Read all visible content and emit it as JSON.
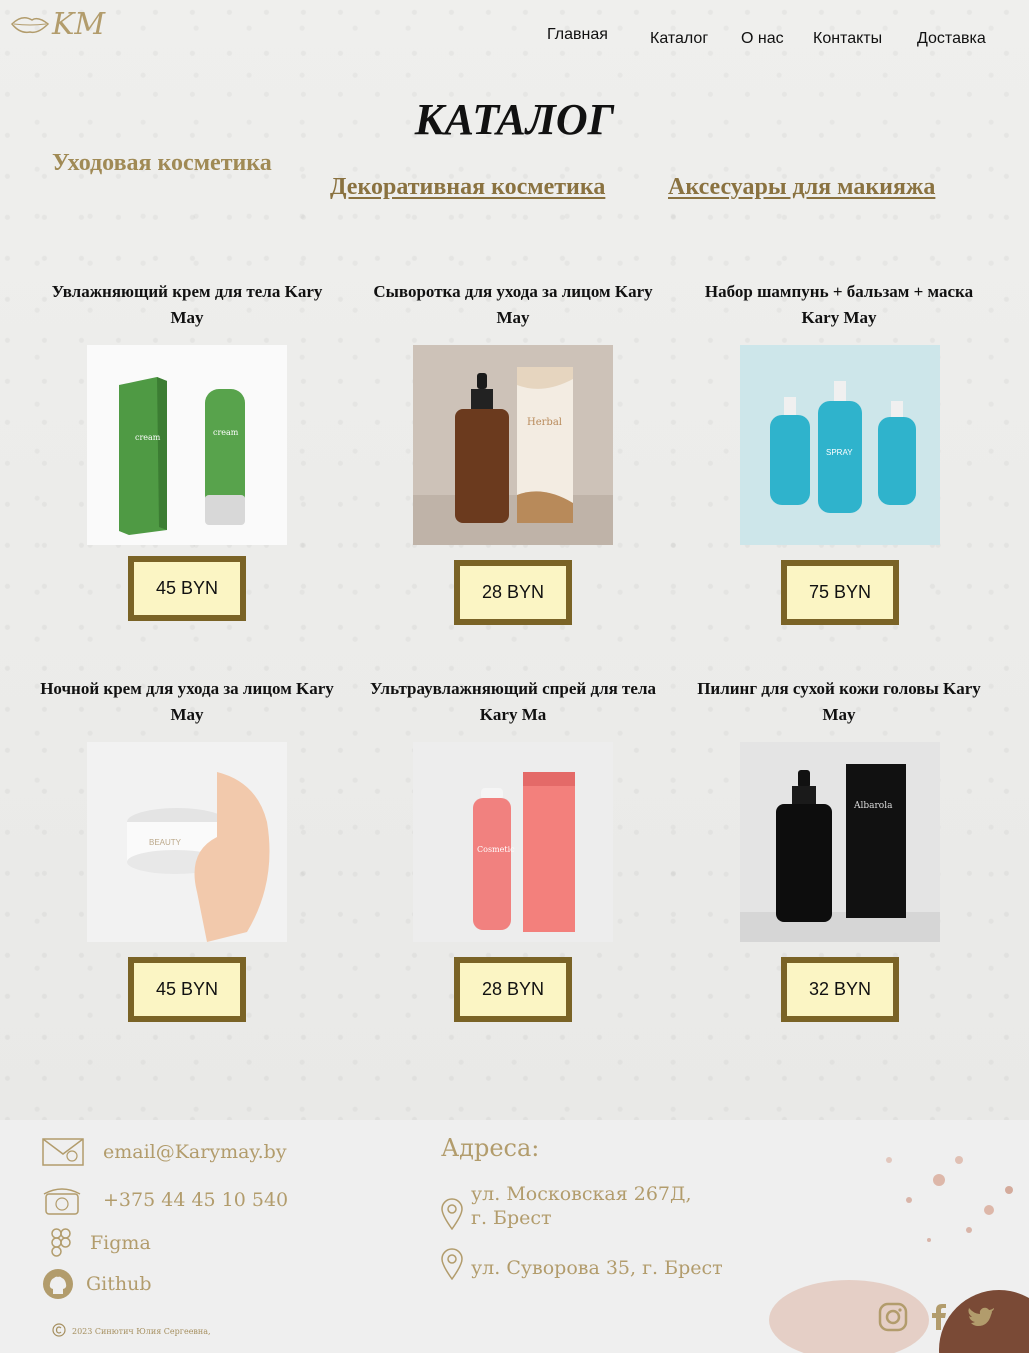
{
  "header": {
    "logo_text": "KM",
    "nav": [
      {
        "label": "Главная"
      },
      {
        "label": "Каталог"
      },
      {
        "label": "О нас"
      },
      {
        "label": "Контакты"
      },
      {
        "label": "Доставка"
      }
    ]
  },
  "catalog": {
    "title": "КАТАЛОГ",
    "tabs": [
      {
        "label": "Уходовая косметика"
      },
      {
        "label": "Декоративная косметика"
      },
      {
        "label": "Аксесуары для макияжа"
      }
    ]
  },
  "products": [
    {
      "title": "Увлажняющий крем для тела Kary May",
      "price": "45 BYN"
    },
    {
      "title": "Сыворотка для ухода за лицом Kary May",
      "price": "28 BYN"
    },
    {
      "title": "Набор шампунь + бальзам + маска Kary May",
      "price": "75 BYN"
    },
    {
      "title": "Ночной крем для ухода за лицом Kary May",
      "price": "45 BYN"
    },
    {
      "title": "Ультраувлажняющий спрей для тела Kary Ma",
      "price": "28 BYN"
    },
    {
      "title": "Пилинг для сухой кожи головы Kary May",
      "price": "32 BYN"
    }
  ],
  "footer": {
    "email": "email@Karymay.by",
    "phone": "+375 44 45 10 540",
    "figma": "Figma",
    "github": "Github",
    "addresses_title": "Адреса:",
    "address_1": "ул. Московская 267Д, г. Брест",
    "address_2": "ул. Суворова 35, г. Брест",
    "copyright": "2023  Синютич Юлия Сергеевна,"
  },
  "colors": {
    "accent": "#7a6326",
    "price_bg": "#fbf5c4",
    "footer_text": "#b29c6c"
  }
}
